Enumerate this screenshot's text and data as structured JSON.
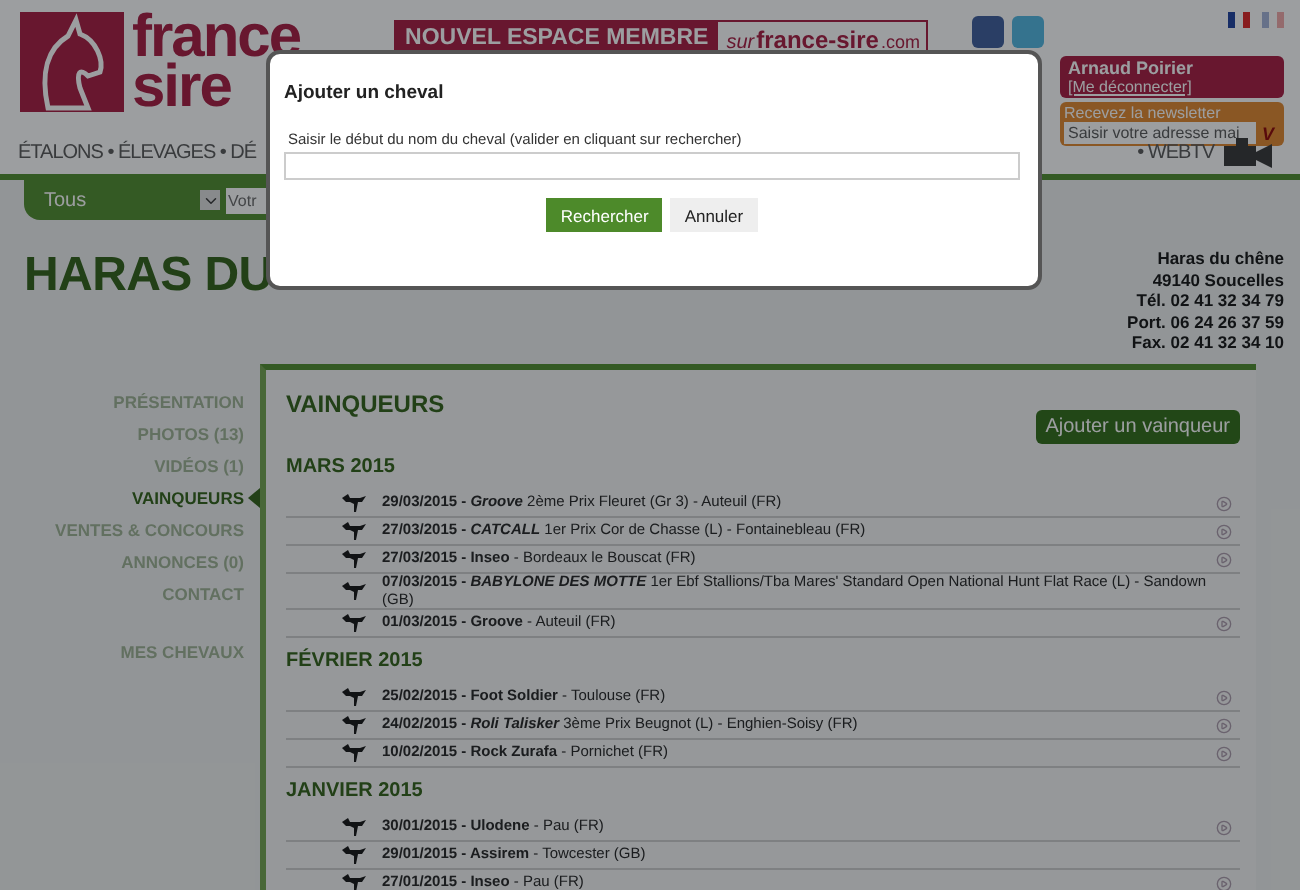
{
  "header": {
    "logo_words": [
      "france",
      "sire"
    ],
    "banner": {
      "lead": "NOUVEL ESPACE MEMBRE",
      "sur": "sur",
      "site": "france-sire",
      "tld": ".com"
    },
    "user": {
      "name": "Arnaud Poirier",
      "logout": "[Me déconnecter]"
    },
    "newsletter": {
      "title": "Recevez la newsletter",
      "placeholder": "Saisir votre adresse mai",
      "submit": "V"
    },
    "languages": [
      {
        "selected": true
      },
      {
        "selected": false
      }
    ]
  },
  "nav": {
    "left": "ÉTALONS • ÉLEVAGES • DÉ",
    "right": "• WEBTV"
  },
  "filter": {
    "select": "Tous",
    "placeholder": "Votr"
  },
  "page_title": "HARAS DU",
  "contact": [
    "Haras du chêne",
    "49140 Soucelles",
    "Tél. 02 41 32 34 79",
    "Port. 06 24 26 37 59",
    "Fax. 02 41 32 34 10"
  ],
  "sidebar": [
    {
      "label": "PRÉSENTATION",
      "selected": false
    },
    {
      "label": "PHOTOS (13)",
      "selected": false
    },
    {
      "label": "VIDÉOS (1)",
      "selected": false
    },
    {
      "label": "VAINQUEURS",
      "selected": true
    },
    {
      "label": "VENTES & CONCOURS",
      "selected": false
    },
    {
      "label": "ANNONCES (0)",
      "selected": false
    },
    {
      "label": "CONTACT",
      "selected": false
    },
    {
      "label": "MES CHEVAUX",
      "selected": false
    }
  ],
  "content": {
    "title": "VAINQUEURS",
    "add_button": "Ajouter un vainqueur",
    "months": [
      {
        "title": "MARS 2015",
        "rows": [
          {
            "date": "29/03/2015 - ",
            "horse": "Groove",
            "italic": true,
            "rest": " 2ème Prix Fleuret (Gr 3) - Auteuil (FR)",
            "video": true
          },
          {
            "date": "27/03/2015 - ",
            "horse": "CATCALL",
            "italic": true,
            "rest": " 1er Prix Cor de Chasse (L) - Fontainebleau (FR)",
            "video": true
          },
          {
            "date": "27/03/2015 - ",
            "horse": "Inseo",
            "italic": false,
            "rest": " - Bordeaux le Bouscat (FR)",
            "video": true
          },
          {
            "date": "07/03/2015 - ",
            "horse": "BABYLONE DES MOTTE",
            "italic": true,
            "rest": " 1er Ebf Stallions/Tba Mares' Standard Open National Hunt Flat Race (L) - Sandown (GB)",
            "video": false
          },
          {
            "date": "01/03/2015 - ",
            "horse": "Groove",
            "italic": false,
            "rest": " - Auteuil (FR)",
            "video": true
          }
        ]
      },
      {
        "title": "FÉVRIER 2015",
        "rows": [
          {
            "date": "25/02/2015 - ",
            "horse": "Foot Soldier",
            "italic": false,
            "rest": " - Toulouse (FR)",
            "video": true
          },
          {
            "date": "24/02/2015 - ",
            "horse": "Roli Talisker",
            "italic": true,
            "rest": " 3ème Prix Beugnot (L) - Enghien-Soisy (FR)",
            "video": true
          },
          {
            "date": "10/02/2015 - ",
            "horse": "Rock Zurafa",
            "italic": false,
            "rest": " - Pornichet (FR)",
            "video": true
          }
        ]
      },
      {
        "title": "JANVIER 2015",
        "rows": [
          {
            "date": "30/01/2015 - ",
            "horse": "Ulodene",
            "italic": false,
            "rest": " - Pau (FR)",
            "video": true
          },
          {
            "date": "29/01/2015 - ",
            "horse": "Assirem",
            "italic": false,
            "rest": " - Towcester (GB)",
            "video": false
          },
          {
            "date": "27/01/2015 - ",
            "horse": "Inseo",
            "italic": false,
            "rest": " - Pau (FR)",
            "video": true
          }
        ]
      }
    ]
  },
  "modal": {
    "title": "Ajouter un cheval",
    "label": "Saisir le début du nom du cheval (valider en cliquant sur rechercher)",
    "search_button": "Rechercher",
    "cancel_button": "Annuler"
  }
}
